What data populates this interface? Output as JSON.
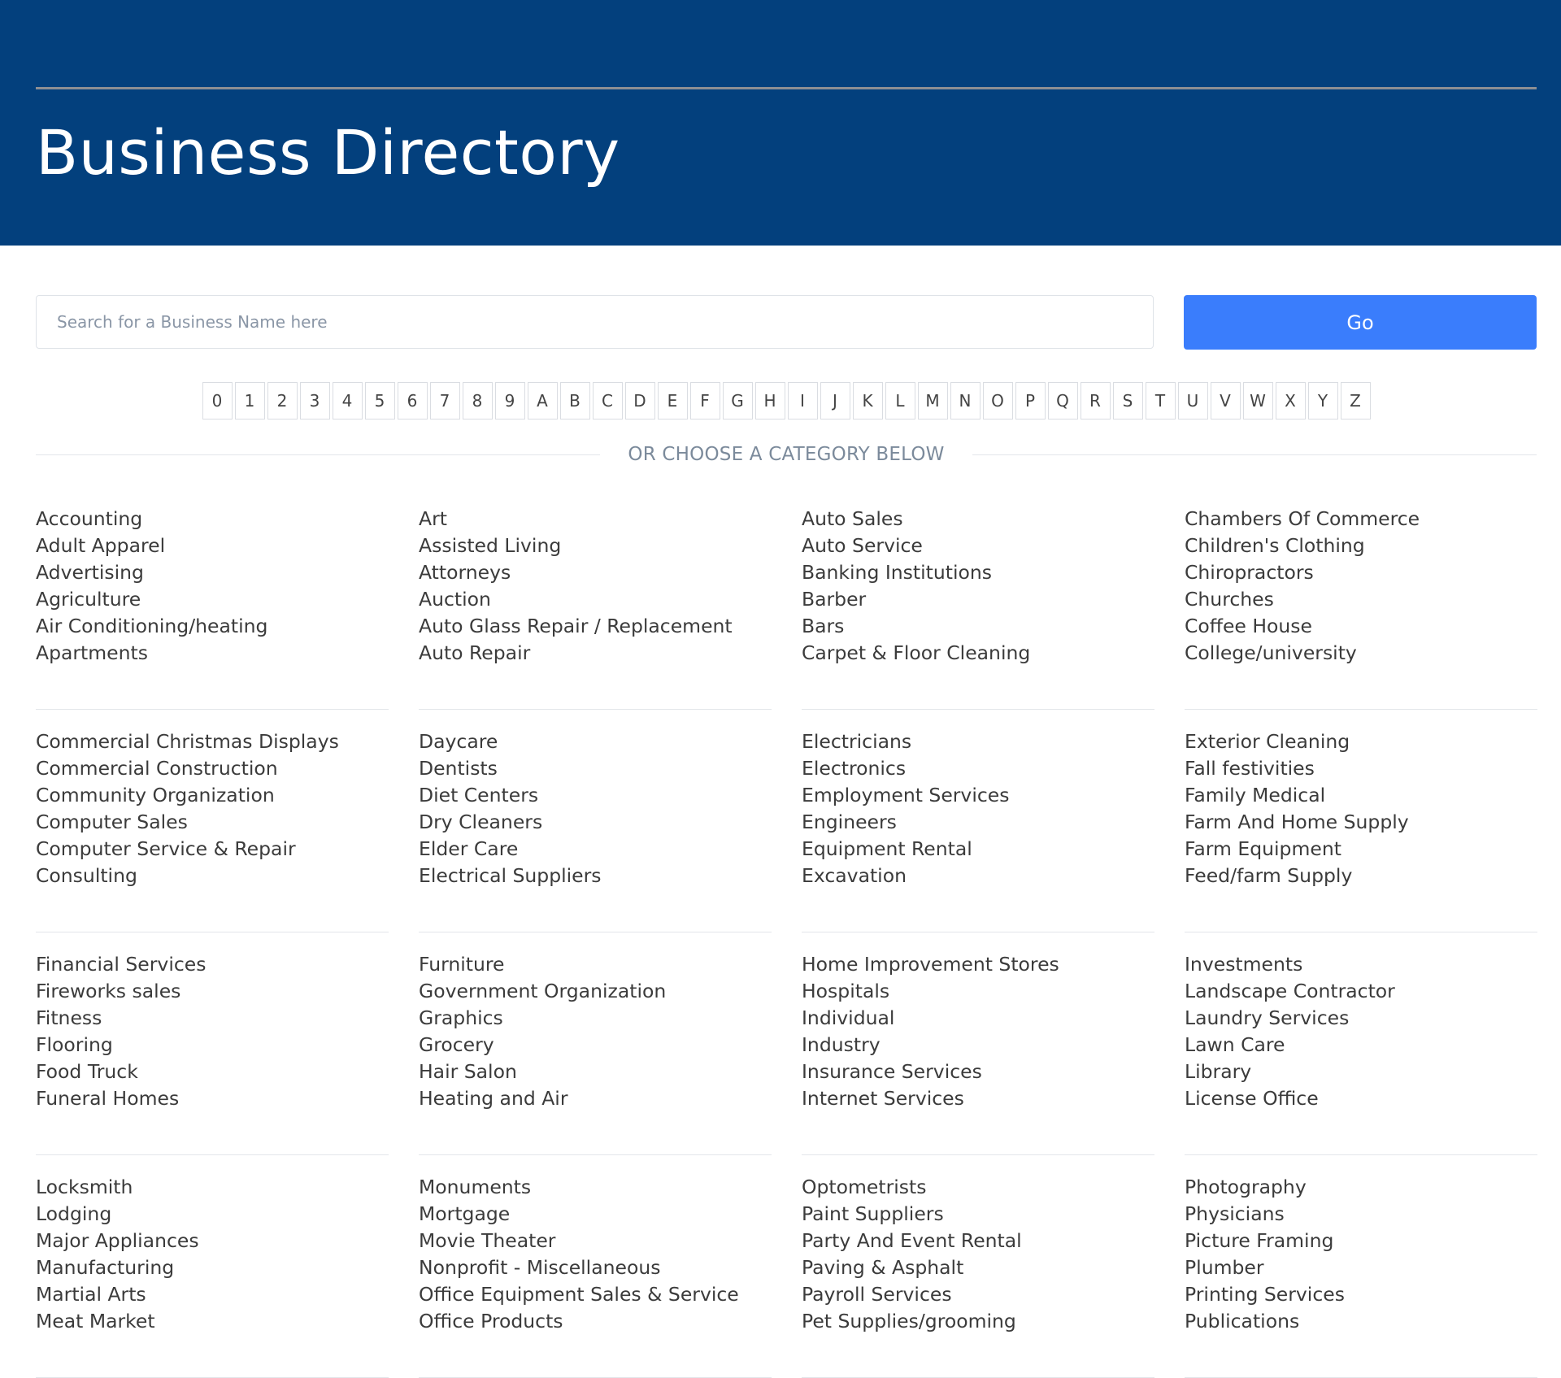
{
  "header": {
    "title": "Business Directory",
    "background": "#03407d"
  },
  "search": {
    "placeholder": "Search for a Business Name here",
    "value": "",
    "go_label": "Go",
    "go_color": "#3a7dfc"
  },
  "alphabet": [
    "0",
    "1",
    "2",
    "3",
    "4",
    "5",
    "6",
    "7",
    "8",
    "9",
    "A",
    "B",
    "C",
    "D",
    "E",
    "F",
    "G",
    "H",
    "I",
    "J",
    "K",
    "L",
    "M",
    "N",
    "O",
    "P",
    "Q",
    "R",
    "S",
    "T",
    "U",
    "V",
    "W",
    "X",
    "Y",
    "Z"
  ],
  "divider_text": "OR CHOOSE A CATEGORY BELOW",
  "category_rows": [
    [
      [
        "Accounting",
        "Adult Apparel",
        "Advertising",
        "Agriculture",
        "Air Conditioning/heating",
        "Apartments"
      ],
      [
        "Art",
        "Assisted Living",
        "Attorneys",
        "Auction",
        "Auto Glass Repair / Replacement",
        "Auto Repair"
      ],
      [
        "Auto Sales",
        "Auto Service",
        "Banking Institutions",
        "Barber",
        "Bars",
        "Carpet & Floor Cleaning"
      ],
      [
        "Chambers Of Commerce",
        "Children's Clothing",
        "Chiropractors",
        "Churches",
        "Coffee House",
        "College/university"
      ]
    ],
    [
      [
        "Commercial Christmas Displays",
        "Commercial Construction",
        "Community Organization",
        "Computer Sales",
        "Computer Service & Repair",
        "Consulting"
      ],
      [
        "Daycare",
        "Dentists",
        "Diet Centers",
        "Dry Cleaners",
        "Elder Care",
        "Electrical Suppliers"
      ],
      [
        "Electricians",
        "Electronics",
        "Employment Services",
        "Engineers",
        "Equipment Rental",
        "Excavation"
      ],
      [
        "Exterior Cleaning",
        "Fall festivities",
        "Family Medical",
        "Farm And Home Supply",
        "Farm Equipment",
        "Feed/farm Supply"
      ]
    ],
    [
      [
        "Financial Services",
        "Fireworks sales",
        "Fitness",
        "Flooring",
        "Food Truck",
        "Funeral Homes"
      ],
      [
        "Furniture",
        "Government Organization",
        "Graphics",
        "Grocery",
        "Hair Salon",
        "Heating and Air"
      ],
      [
        "Home Improvement Stores",
        "Hospitals",
        "Individual",
        "Industry",
        "Insurance Services",
        "Internet Services"
      ],
      [
        "Investments",
        "Landscape Contractor",
        "Laundry Services",
        "Lawn Care",
        "Library",
        "License Office"
      ]
    ],
    [
      [
        "Locksmith",
        "Lodging",
        "Major Appliances",
        "Manufacturing",
        "Martial Arts",
        "Meat Market"
      ],
      [
        "Monuments",
        "Mortgage",
        "Movie Theater",
        "Nonprofit - Miscellaneous",
        "Office Equipment Sales & Service",
        "Office Products"
      ],
      [
        "Optometrists",
        "Paint Suppliers",
        "Party And Event Rental",
        "Paving & Asphalt",
        "Payroll Services",
        "Pet Supplies/grooming"
      ],
      [
        "Photography",
        "Physicians",
        "Picture Framing",
        "Plumber",
        "Printing Services",
        "Publications"
      ]
    ]
  ]
}
